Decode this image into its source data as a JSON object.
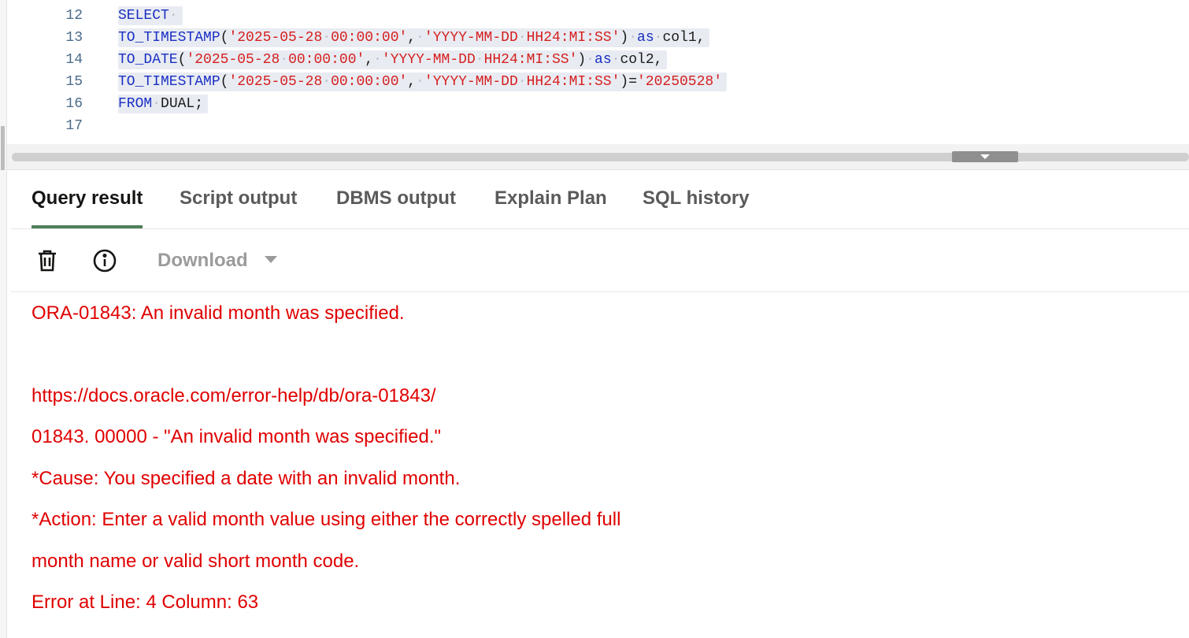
{
  "editor": {
    "lines": [
      {
        "number": "12",
        "tokens": [
          {
            "t": "SELECT",
            "c": "kw"
          },
          {
            "t": "·",
            "c": "ws"
          }
        ]
      },
      {
        "number": "13",
        "tokens": [
          {
            "t": "TO_TIMESTAMP",
            "c": "kw"
          },
          {
            "t": "(",
            "c": "plain"
          },
          {
            "t": "'2025-05-28",
            "c": "str"
          },
          {
            "t": "·",
            "c": "ws"
          },
          {
            "t": "00:00:00'",
            "c": "str"
          },
          {
            "t": ",",
            "c": "plain"
          },
          {
            "t": "·",
            "c": "ws"
          },
          {
            "t": "'YYYY-MM-DD",
            "c": "str"
          },
          {
            "t": "·",
            "c": "ws"
          },
          {
            "t": "HH24:MI:SS'",
            "c": "str"
          },
          {
            "t": ")",
            "c": "plain"
          },
          {
            "t": "·",
            "c": "ws"
          },
          {
            "t": "as",
            "c": "kw"
          },
          {
            "t": "·",
            "c": "ws"
          },
          {
            "t": "col1,",
            "c": "plain"
          }
        ]
      },
      {
        "number": "14",
        "tokens": [
          {
            "t": "TO_DATE",
            "c": "kw"
          },
          {
            "t": "(",
            "c": "plain"
          },
          {
            "t": "'2025-05-28",
            "c": "str"
          },
          {
            "t": "·",
            "c": "ws"
          },
          {
            "t": "00:00:00'",
            "c": "str"
          },
          {
            "t": ",",
            "c": "plain"
          },
          {
            "t": "·",
            "c": "ws"
          },
          {
            "t": "'YYYY-MM-DD",
            "c": "str"
          },
          {
            "t": "·",
            "c": "ws"
          },
          {
            "t": "HH24:MI:SS'",
            "c": "str"
          },
          {
            "t": ")",
            "c": "plain"
          },
          {
            "t": "·",
            "c": "ws"
          },
          {
            "t": "as",
            "c": "kw"
          },
          {
            "t": "·",
            "c": "ws"
          },
          {
            "t": "col2,",
            "c": "plain"
          }
        ]
      },
      {
        "number": "15",
        "tokens": [
          {
            "t": "TO_TIMESTAMP",
            "c": "kw"
          },
          {
            "t": "(",
            "c": "plain"
          },
          {
            "t": "'2025-05-28",
            "c": "str"
          },
          {
            "t": "·",
            "c": "ws"
          },
          {
            "t": "00:00:00'",
            "c": "str"
          },
          {
            "t": ",",
            "c": "plain"
          },
          {
            "t": "·",
            "c": "ws"
          },
          {
            "t": "'YYYY-MM-DD",
            "c": "str"
          },
          {
            "t": "·",
            "c": "ws"
          },
          {
            "t": "HH24:MI:SS'",
            "c": "str"
          },
          {
            "t": ")=",
            "c": "plain"
          },
          {
            "t": "'20250528'",
            "c": "str"
          }
        ]
      },
      {
        "number": "16",
        "tokens": [
          {
            "t": "FROM",
            "c": "kw"
          },
          {
            "t": "·",
            "c": "ws"
          },
          {
            "t": "DUAL;",
            "c": "plain"
          }
        ]
      },
      {
        "number": "17",
        "tokens": []
      }
    ]
  },
  "tabs": [
    {
      "label": "Query result",
      "active": true
    },
    {
      "label": "Script output",
      "active": false
    },
    {
      "label": "DBMS output",
      "active": false
    },
    {
      "label": "Explain Plan",
      "active": false
    },
    {
      "label": "SQL history",
      "active": false
    }
  ],
  "toolbar": {
    "clear_icon": "trash-icon",
    "info_icon": "info-icon",
    "download_label": "Download",
    "download_menu_icon": "caret-down-icon"
  },
  "output": {
    "lines": [
      "ORA-01843: An invalid month was specified.",
      "https://docs.oracle.com/error-help/db/ora-01843/",
      "01843. 00000 -  \"An invalid month was specified.\"",
      "*Cause:    You specified a date with an invalid month.",
      "*Action:   Enter a valid month value using either the correctly spelled full",
      "           month name or valid short month code.",
      "Error at Line: 4 Column: 63"
    ]
  },
  "colors": {
    "keyword": "#1b2fc4",
    "string": "#d61f1f",
    "error": "#e00000",
    "active_tab_underline": "#4f8058"
  }
}
